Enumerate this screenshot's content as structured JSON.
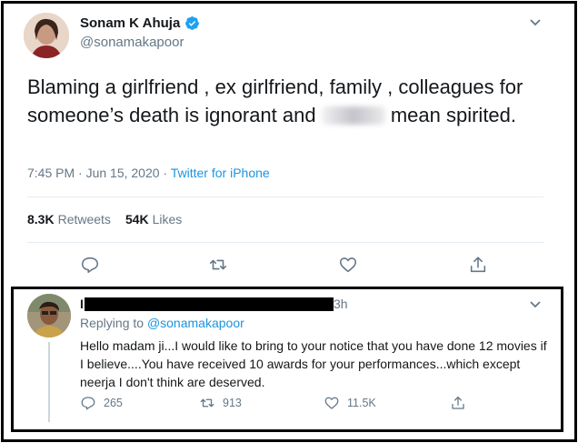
{
  "tweet": {
    "author_name": "Sonam K Ahuja",
    "author_handle": "@sonamakapoor",
    "text_part1": "Blaming a girlfriend , ex girlfriend, family , colleagues for someone’s death is ignorant and ",
    "text_part2": " mean spirited.",
    "timestamp": "7:45 PM · Jun 15, 2020 · ",
    "source": "Twitter for iPhone",
    "retweets_count": "8.3K",
    "retweets_label": "Retweets",
    "likes_count": "54K",
    "likes_label": "Likes"
  },
  "reply": {
    "name_visible": "I",
    "time": "3h",
    "replying_prefix": "Replying to ",
    "replying_handle": "@sonamakapoor",
    "text": "Hello madam ji...I would like to bring to your notice that you have done 12 movies if I believe....You have received 10 awards for your performances...which except neerja I don't think are deserved.",
    "reply_count": "265",
    "retweet_count": "913",
    "like_count": "11.5K"
  },
  "colors": {
    "accent": "#1b95e0",
    "secondary_text": "#657786",
    "icon": "#657786"
  },
  "icons": [
    "verified-badge-icon",
    "chevron-down-icon",
    "reply-icon",
    "retweet-icon",
    "like-icon",
    "share-icon"
  ]
}
